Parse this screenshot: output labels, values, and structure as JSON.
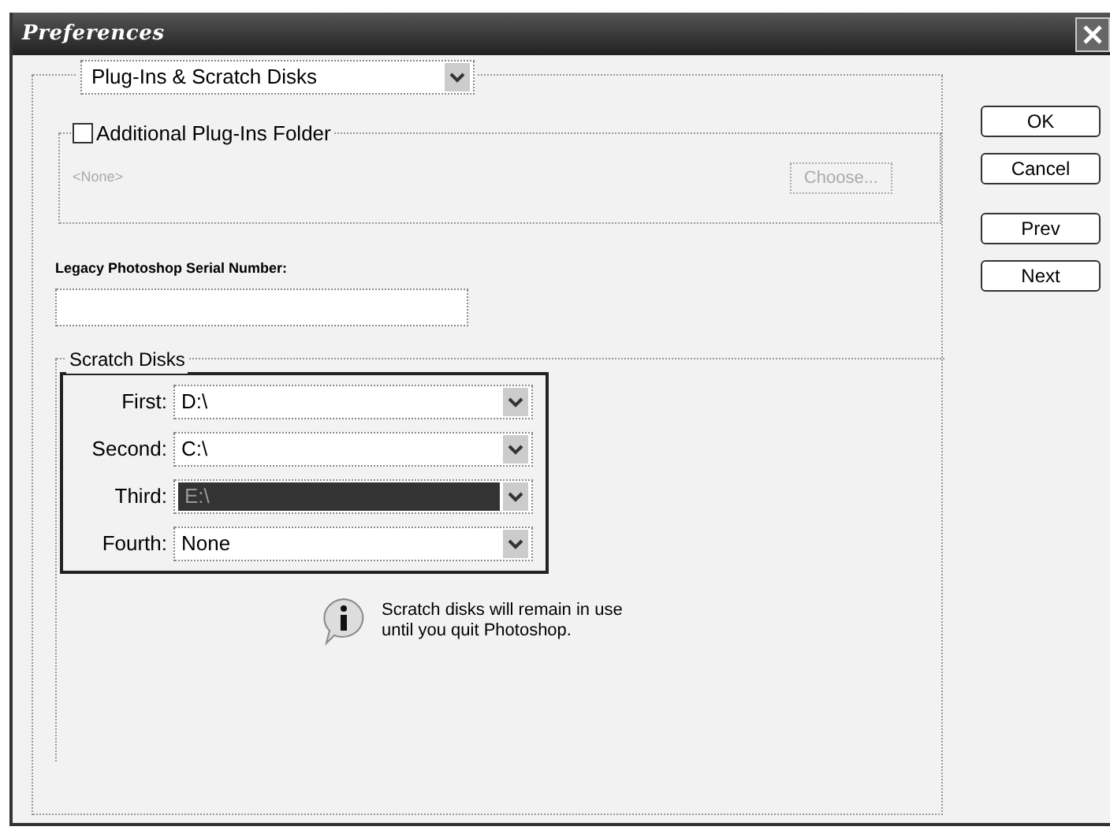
{
  "window": {
    "title": "Preferences"
  },
  "section_dropdown": {
    "value": "Plug-Ins & Scratch Disks"
  },
  "plugins_folder": {
    "label": "Additional Plug-Ins Folder",
    "checked": false,
    "path": "<None>",
    "choose_button": {
      "label": "Choose...",
      "disabled": true
    }
  },
  "serial": {
    "label": "Legacy Photoshop Serial Number:"
  },
  "scratch_disks": {
    "title": "Scratch Disks",
    "disks": [
      {
        "label": "First:",
        "value": "D:\\",
        "selected": false
      },
      {
        "label": "Second:",
        "value": "C:\\",
        "selected": false
      },
      {
        "label": "Third:",
        "value": "E:\\",
        "selected": true
      },
      {
        "label": "Fourth:",
        "value": "None",
        "selected": false
      }
    ],
    "note": "Scratch disks will remain in use until you quit Photoshop."
  },
  "buttons": [
    {
      "label": "OK"
    },
    {
      "label": "Cancel"
    },
    {
      "label": "Prev"
    },
    {
      "label": "Next"
    }
  ]
}
